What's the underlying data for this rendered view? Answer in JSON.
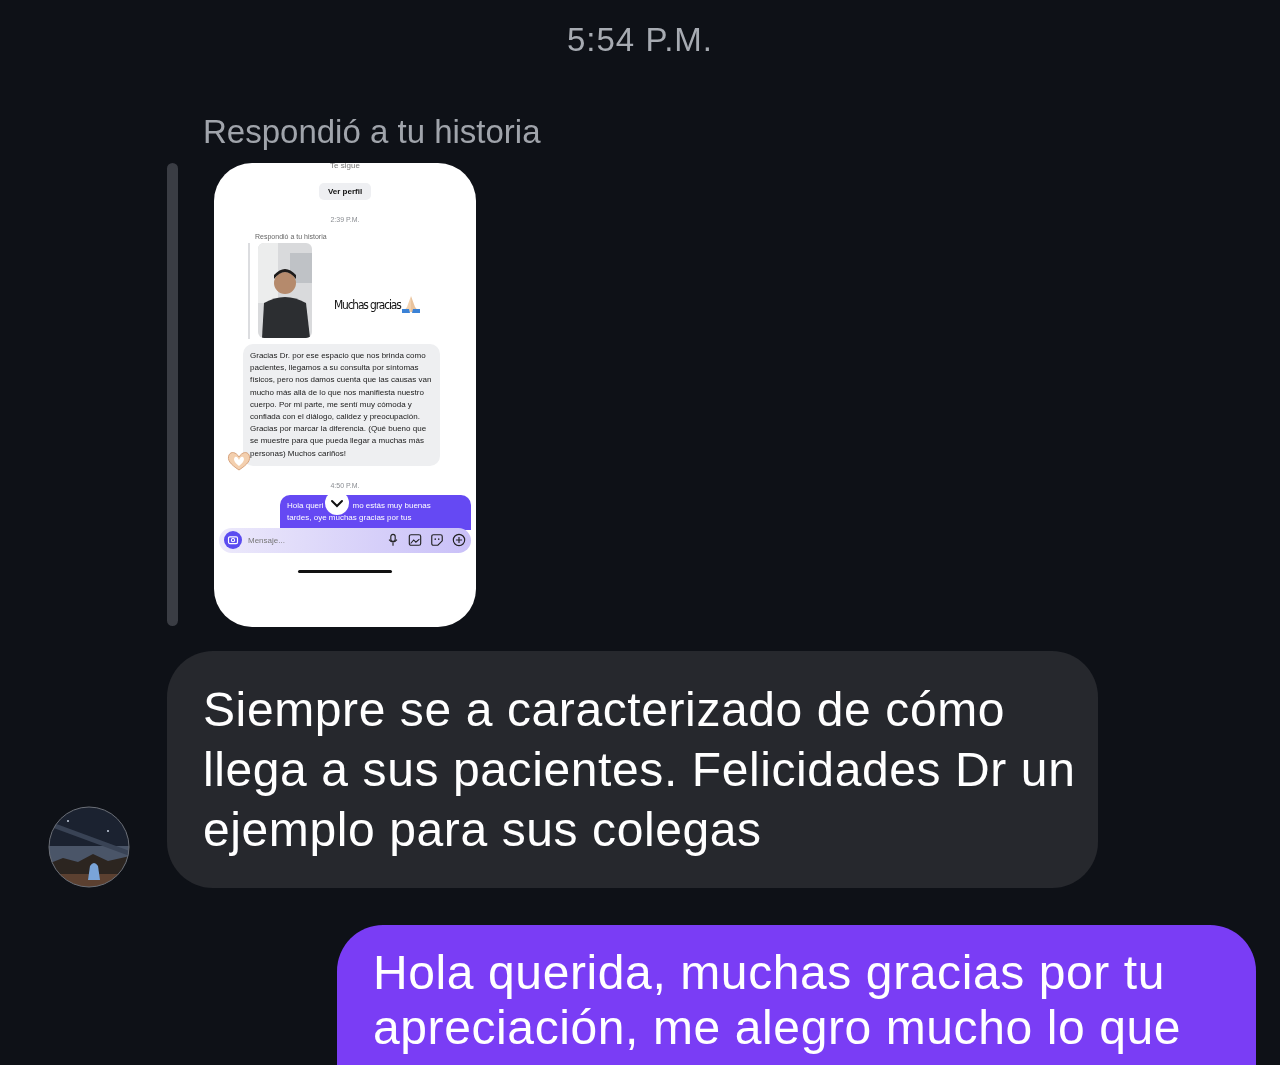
{
  "time": "5:54 P.M.",
  "reply_label": "Respondió a tu historia",
  "story": {
    "kind": "screenshot",
    "top_text": "Te sigue",
    "profile_button": "Ver perfil",
    "time_1": "2:39 P.M.",
    "reply_label": "Respondió a tu historia",
    "sticker_text": "Muchas gracias",
    "message": "Gracias Dr. por ese espacio que nos brinda como pacientes, llegamos a su consulta por síntomas físicos, pero nos damos cuenta que las causas van mucho más allá de lo que nos manifiesta nuestro cuerpo. Por mi parte, me sentí muy cómoda y confiada con el diálogo, calidez y preocupación. Gracias por marcar la diferencia. (Qué bueno que se muestre para que pueda llegar a muchas más personas) Muchos cariños!",
    "time_2": "4:50 P.M.",
    "sent_lines": [
      "Hola queri",
      "mo estás muy buenas",
      "tardes, oye muchas gracias por tus"
    ],
    "input_placeholder": "Mensaje..."
  },
  "messages": [
    {
      "kind": "received",
      "text": "Siempre se a caracterizado de cómo llega a sus pacientes. Felicidades Dr un ejemplo para sus colegas"
    },
    {
      "kind": "sent",
      "text": "Hola querida, muchas gracias por tu apreciación, me alegro mucho lo que"
    }
  ]
}
